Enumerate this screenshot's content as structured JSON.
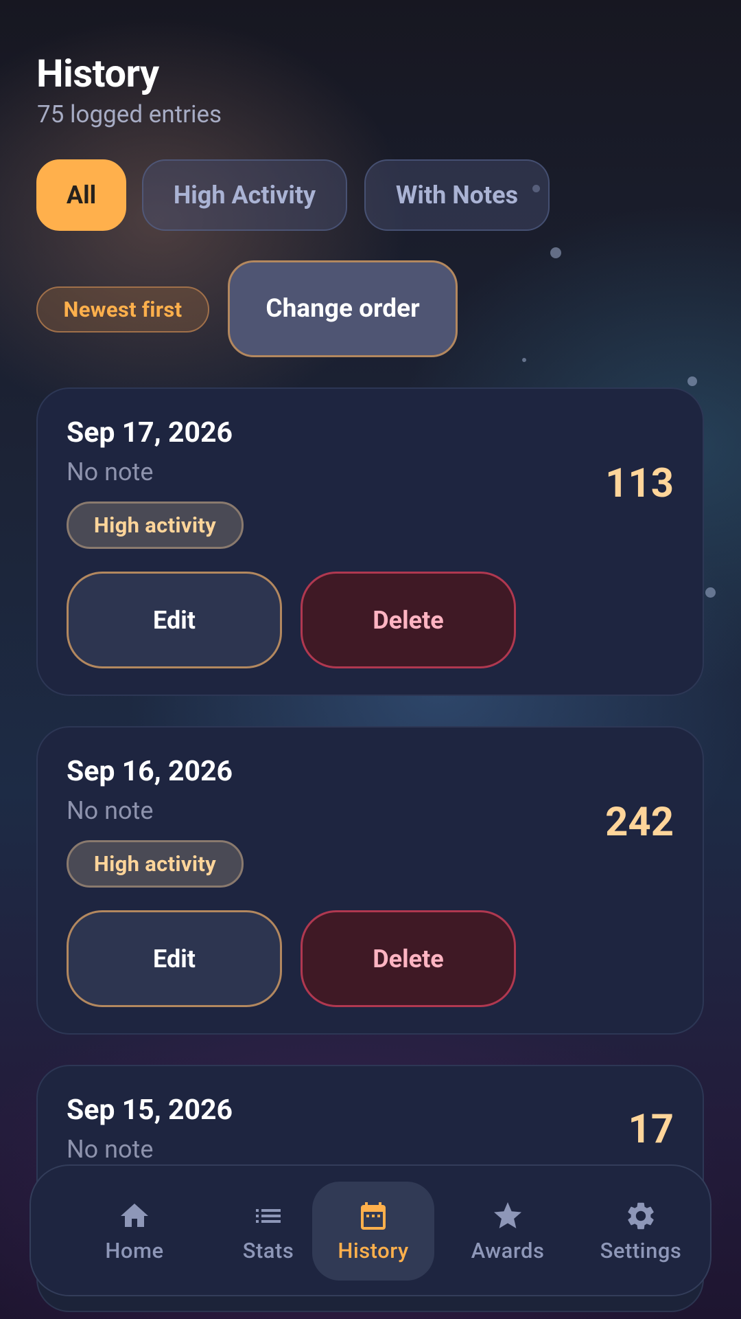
{
  "header": {
    "title": "History",
    "subtitle": "75 logged entries"
  },
  "filters": [
    {
      "label": "All",
      "active": true
    },
    {
      "label": "High Activity",
      "active": false
    },
    {
      "label": "With Notes",
      "active": false
    }
  ],
  "sort": {
    "badge": "Newest first",
    "change_button": "Change order"
  },
  "entries": [
    {
      "date": "Sep 17, 2026",
      "note": "No note",
      "value": "113",
      "tag": "High activity",
      "edit_label": "Edit",
      "delete_label": "Delete"
    },
    {
      "date": "Sep 16, 2026",
      "note": "No note",
      "value": "242",
      "tag": "High activity",
      "edit_label": "Edit",
      "delete_label": "Delete"
    },
    {
      "date": "Sep 15, 2026",
      "note": "No note",
      "value": "17"
    }
  ],
  "nav": {
    "items": [
      {
        "label": "Home",
        "icon": "home-icon",
        "active": false
      },
      {
        "label": "Stats",
        "icon": "list-icon",
        "active": false
      },
      {
        "label": "History",
        "icon": "calendar-icon",
        "active": true
      },
      {
        "label": "Awards",
        "icon": "star-icon",
        "active": false
      },
      {
        "label": "Settings",
        "icon": "gear-icon",
        "active": false
      }
    ]
  },
  "colors": {
    "accent": "#ffb04c",
    "value": "#ffd59a",
    "card": "#1e2540",
    "danger_bg": "#3f1925",
    "danger_text": "#ffb4c2"
  }
}
